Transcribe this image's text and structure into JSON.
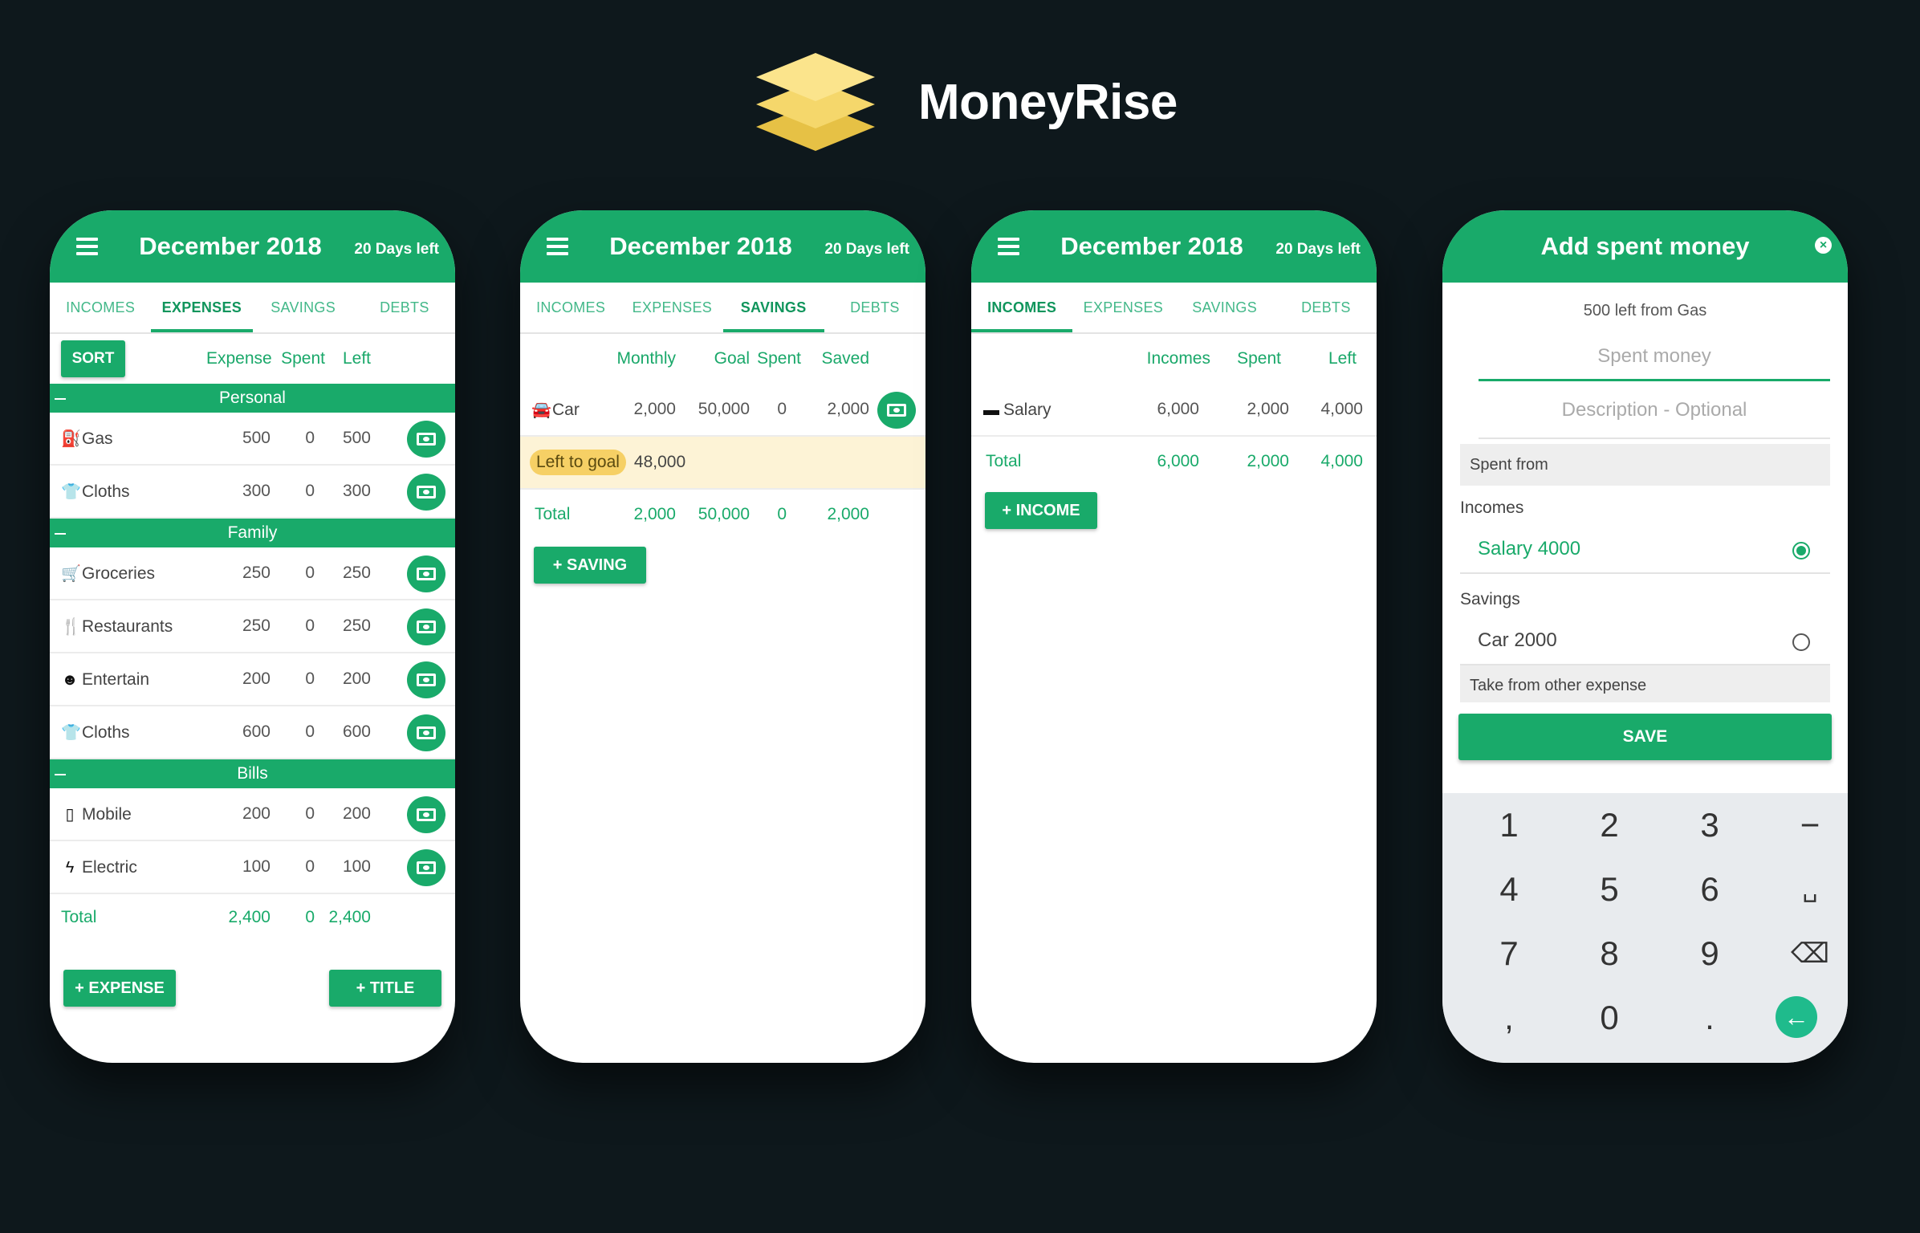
{
  "brand": {
    "name": "MoneyRise",
    "logo_colors": [
      "#fbe48c",
      "#f5d76b",
      "#e6c145"
    ]
  },
  "colors": {
    "accent": "#19aa6a",
    "background": "#0e181c",
    "goal_bg": "#fdf3d6"
  },
  "tabs": [
    "INCOMES",
    "EXPENSES",
    "SAVINGS",
    "DEBTS"
  ],
  "month_header": {
    "title": "December 2018",
    "days_left": "20 Days left"
  },
  "expenses_screen": {
    "active_tab": "EXPENSES",
    "sort_label": "SORT",
    "columns": [
      "Expense",
      "Spent",
      "Left"
    ],
    "sections": [
      {
        "title": "Personal",
        "items": [
          {
            "icon": "gas-icon",
            "glyph": "⛽",
            "name": "Gas",
            "expense": "500",
            "spent": "0",
            "left": "500"
          },
          {
            "icon": "shirt-icon",
            "glyph": "👕",
            "name": "Cloths",
            "expense": "300",
            "spent": "0",
            "left": "300"
          }
        ]
      },
      {
        "title": "Family",
        "items": [
          {
            "icon": "cart-icon",
            "glyph": "🛒",
            "name": "Groceries",
            "expense": "250",
            "spent": "0",
            "left": "250"
          },
          {
            "icon": "fork-knife-icon",
            "glyph": "🍴",
            "name": "Restaurants",
            "expense": "250",
            "spent": "0",
            "left": "250"
          },
          {
            "icon": "entertain-icon",
            "glyph": "☻",
            "name": "Entertain",
            "expense": "200",
            "spent": "0",
            "left": "200"
          },
          {
            "icon": "shirt-icon",
            "glyph": "👕",
            "name": "Cloths",
            "expense": "600",
            "spent": "0",
            "left": "600"
          }
        ]
      },
      {
        "title": "Bills",
        "items": [
          {
            "icon": "mobile-icon",
            "glyph": "▯",
            "name": "Mobile",
            "expense": "200",
            "spent": "0",
            "left": "200"
          },
          {
            "icon": "bolt-icon",
            "glyph": "ϟ",
            "name": "Electric",
            "expense": "100",
            "spent": "0",
            "left": "100"
          }
        ]
      }
    ],
    "total": {
      "label": "Total",
      "expense": "2,400",
      "spent": "0",
      "left": "2,400"
    },
    "add_expense": "+ EXPENSE",
    "add_title": "+ TITLE"
  },
  "savings_screen": {
    "active_tab": "SAVINGS",
    "columns": [
      "Monthly",
      "Goal",
      "Spent",
      "Saved"
    ],
    "item": {
      "icon": "car-icon",
      "name": "Car",
      "monthly": "2,000",
      "goal": "50,000",
      "spent": "0",
      "saved": "2,000"
    },
    "left_to_goal_label": "Left to goal",
    "left_to_goal_value": "48,000",
    "total": {
      "label": "Total",
      "monthly": "2,000",
      "goal": "50,000",
      "spent": "0",
      "saved": "2,000"
    },
    "add_saving": "+ SAVING"
  },
  "incomes_screen": {
    "active_tab": "INCOMES",
    "columns": [
      "Incomes",
      "Spent",
      "Left"
    ],
    "item": {
      "icon": "wallet-icon",
      "name": "Salary",
      "incomes": "6,000",
      "spent": "2,000",
      "left": "4,000"
    },
    "total": {
      "label": "Total",
      "incomes": "6,000",
      "spent": "2,000",
      "left": "4,000"
    },
    "add_income": "+ INCOME"
  },
  "add_spent_screen": {
    "title": "Add spent money",
    "close_glyph": "×",
    "note": "500 left from Gas",
    "spent_placeholder": "Spent money",
    "description_placeholder": "Description - Optional",
    "spent_from_label": "Spent from",
    "incomes_label": "Incomes",
    "income_option": "Salary 4000",
    "savings_label": "Savings",
    "saving_option": "Car 2000",
    "take_from_label": "Take from other expense",
    "save_label": "SAVE",
    "keys": [
      [
        "1",
        "2",
        "3",
        "−"
      ],
      [
        "4",
        "5",
        "6",
        "␣"
      ],
      [
        "7",
        "8",
        "9",
        "⌫"
      ],
      [
        ",",
        "0",
        ".",
        "←"
      ]
    ]
  }
}
